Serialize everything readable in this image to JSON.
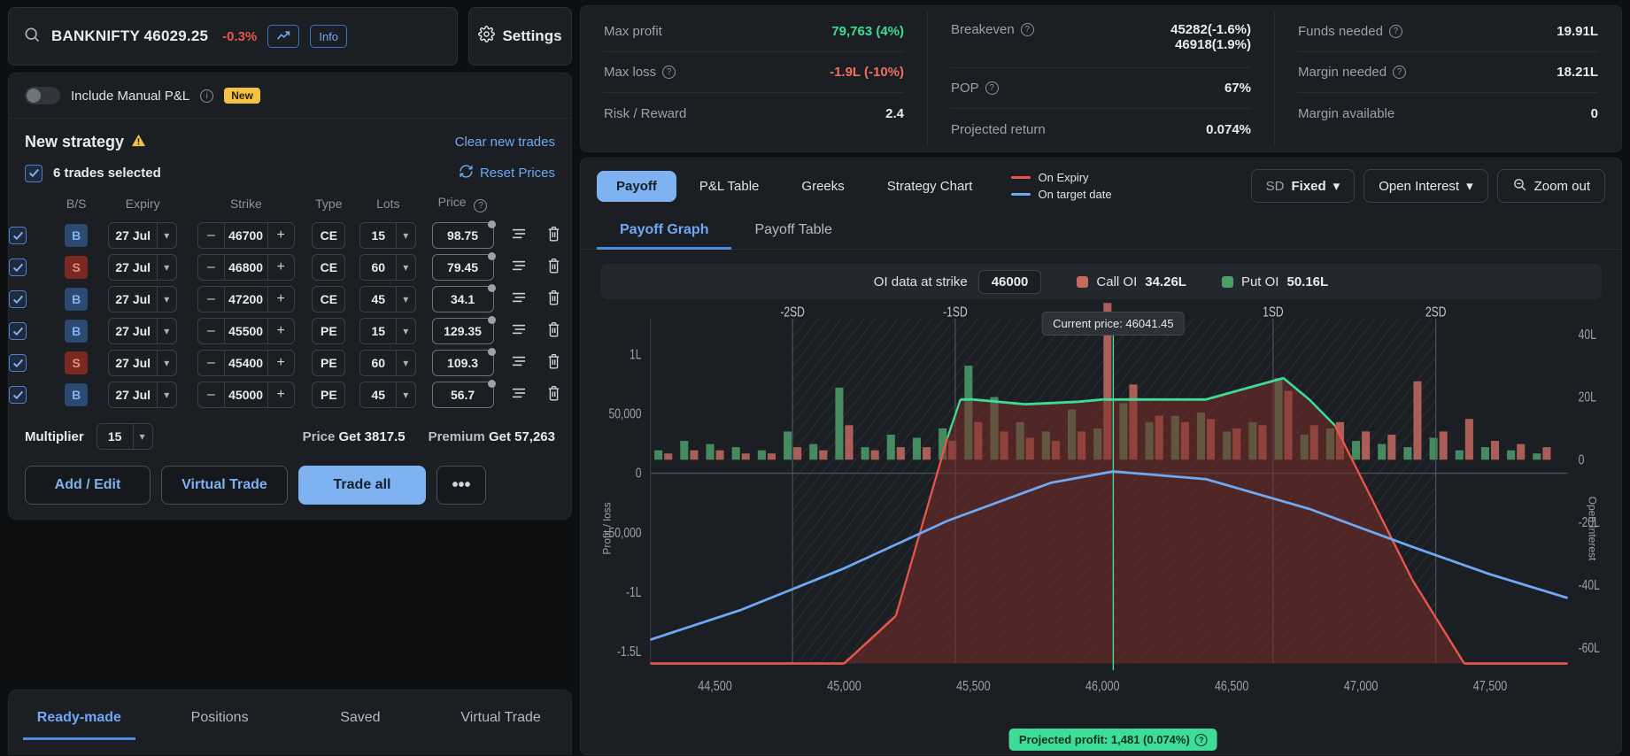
{
  "search": {
    "symbol": "BANKNIFTY 46029.25",
    "change": "-0.3%",
    "chart_icon": "trend-up-icon",
    "info_label": "Info",
    "search_icon": "search-icon"
  },
  "settings": {
    "label": "Settings",
    "icon": "gear-icon"
  },
  "manual_pnl": {
    "label": "Include Manual P&L",
    "badge": "New",
    "info_icon": "info-icon"
  },
  "strategy": {
    "title": "New strategy",
    "warning_icon": "warning-icon",
    "clear_label": "Clear new trades",
    "selected_label": "6 trades selected",
    "reset_label": "Reset Prices",
    "reset_icon": "refresh-icon",
    "columns": [
      "B/S",
      "Expiry",
      "Strike",
      "Type",
      "Lots",
      "Price"
    ],
    "rows": [
      {
        "bs": "B",
        "expiry": "27 Jul",
        "strike": "46700",
        "type": "CE",
        "lots": "15",
        "price": "98.75"
      },
      {
        "bs": "S",
        "expiry": "27 Jul",
        "strike": "46800",
        "type": "CE",
        "lots": "60",
        "price": "79.45"
      },
      {
        "bs": "B",
        "expiry": "27 Jul",
        "strike": "47200",
        "type": "CE",
        "lots": "45",
        "price": "34.1"
      },
      {
        "bs": "B",
        "expiry": "27 Jul",
        "strike": "45500",
        "type": "PE",
        "lots": "15",
        "price": "129.35"
      },
      {
        "bs": "S",
        "expiry": "27 Jul",
        "strike": "45400",
        "type": "PE",
        "lots": "60",
        "price": "109.3"
      },
      {
        "bs": "B",
        "expiry": "27 Jul",
        "strike": "45000",
        "type": "PE",
        "lots": "45",
        "price": "56.7"
      }
    ],
    "multiplier_label": "Multiplier",
    "multiplier_value": "15",
    "price_label": "Price",
    "price_value": "Get 3817.5",
    "premium_label": "Premium",
    "premium_value": "Get 57,263",
    "buttons": {
      "add_edit": "Add / Edit",
      "virtual_trade": "Virtual Trade",
      "trade_all": "Trade all",
      "more": "•••"
    }
  },
  "bottom_tabs": [
    {
      "label": "Ready-made",
      "active": true
    },
    {
      "label": "Positions",
      "active": false
    },
    {
      "label": "Saved",
      "active": false
    },
    {
      "label": "Virtual Trade",
      "active": false
    }
  ],
  "metrics": {
    "col1": [
      {
        "label": "Max profit",
        "value": "79,763 (4%)",
        "tone": "green",
        "help": false
      },
      {
        "label": "Max loss",
        "value": "-1.9L (-10%)",
        "tone": "red",
        "help": true
      },
      {
        "label": "Risk / Reward",
        "value": "2.4",
        "tone": "plain",
        "help": false
      }
    ],
    "col2": [
      {
        "label": "Breakeven",
        "value": "45282(-1.6%)",
        "value2": "46918(1.9%)",
        "tone": "plain",
        "help": true
      },
      {
        "label": "POP",
        "value": "67%",
        "tone": "plain",
        "help": true
      },
      {
        "label": "Projected return",
        "value": "0.074%",
        "tone": "plain",
        "help": false
      }
    ],
    "col3": [
      {
        "label": "Funds needed",
        "value": "19.91L",
        "tone": "plain",
        "help": true
      },
      {
        "label": "Margin needed",
        "value": "18.21L",
        "tone": "plain",
        "help": true
      },
      {
        "label": "Margin available",
        "value": "0",
        "tone": "plain",
        "help": false
      }
    ]
  },
  "chart_controls": {
    "tabs": [
      {
        "label": "Payoff",
        "active": true
      },
      {
        "label": "P&L Table",
        "active": false
      },
      {
        "label": "Greeks",
        "active": false
      },
      {
        "label": "Strategy Chart",
        "active": false
      }
    ],
    "legend": [
      {
        "label": "On Expiry",
        "color": "#e8564a"
      },
      {
        "label": "On target date",
        "color": "#6fa8f5"
      }
    ],
    "sd_prefix": "SD",
    "sd_value": "Fixed",
    "oi_dropdown": "Open Interest",
    "zoom_out": "Zoom out",
    "zoom_icon": "zoom-out-icon",
    "chevron_icon": "chevron-down-icon"
  },
  "sub_tabs": [
    {
      "label": "Payoff Graph",
      "active": true
    },
    {
      "label": "Payoff Table",
      "active": false
    }
  ],
  "oi_bar": {
    "strike_label": "OI data at strike",
    "strike_value": "46000",
    "call_label": "Call OI",
    "call_value": "34.26L",
    "call_color": "#c46a60",
    "put_label": "Put OI",
    "put_value": "50.16L",
    "put_color": "#4e9e6a"
  },
  "chart_annotations": {
    "current_price": "Current price: 46041.45",
    "projected_profit": "Projected profit: 1,481 (0.074%)",
    "y_axis_left_title": "Profit / loss",
    "y_axis_right_title": "Open Interest"
  },
  "chart_data": {
    "type": "line",
    "title": "Payoff Graph",
    "xlabel": "",
    "ylabel": "Profit / loss",
    "y2label": "Open Interest",
    "xlim": [
      44250,
      47800
    ],
    "ylim": [
      -160000,
      130000
    ],
    "y2lim": [
      -65,
      45
    ],
    "xticks": [
      44500,
      45000,
      45500,
      46000,
      46500,
      47000,
      47500
    ],
    "xticklabels": [
      "44,500",
      "45,000",
      "45,500",
      "46,000",
      "46,500",
      "47,000",
      "47,500"
    ],
    "yticks": [
      -150000,
      -100000,
      -50000,
      0,
      50000,
      100000
    ],
    "yticklabels": [
      "-1.5L",
      "-1L",
      "-50,000",
      "0",
      "50,000",
      "1L"
    ],
    "y2ticks": [
      -60,
      -40,
      -20,
      0,
      20,
      40
    ],
    "y2ticklabels": [
      "-60L",
      "-40L",
      "-20L",
      "0",
      "20L",
      "40L"
    ],
    "sd_markers": [
      {
        "label": "-2SD",
        "x": 44800
      },
      {
        "label": "-1SD",
        "x": 45430
      },
      {
        "label": "1SD",
        "x": 46660
      },
      {
        "label": "2SD",
        "x": 47290
      }
    ],
    "current_price_x": 46041.45,
    "grid": false,
    "legend_position": "top-left",
    "series": [
      {
        "name": "On Expiry",
        "color_profit": "#3ddc97",
        "color_loss": "#e8564a",
        "x": [
          44250,
          45000,
          45200,
          45400,
          45450,
          45500,
          45700,
          45900,
          46000,
          46100,
          46400,
          46700,
          46800,
          46900,
          47200,
          47400,
          47800
        ],
        "y": [
          -160000,
          -160000,
          -120000,
          30000,
          62000,
          62000,
          58000,
          60000,
          62000,
          62000,
          62000,
          80000,
          62000,
          40000,
          -90000,
          -160000,
          -160000
        ]
      },
      {
        "name": "On target date",
        "color": "#6fa8f5",
        "x": [
          44250,
          44600,
          45000,
          45400,
          45800,
          46041,
          46400,
          46800,
          47200,
          47500,
          47800
        ],
        "y": [
          -140000,
          -115000,
          -80000,
          -40000,
          -8000,
          1481,
          -5000,
          -30000,
          -62000,
          -85000,
          -105000
        ]
      }
    ],
    "oi_bars": {
      "note": "Open interest histogram, call OI (red) and put OI (green) per strike",
      "strikes": [
        44300,
        44400,
        44500,
        44600,
        44700,
        44800,
        44900,
        45000,
        45100,
        45200,
        45300,
        45400,
        45500,
        45600,
        45700,
        45800,
        45900,
        46000,
        46100,
        46200,
        46300,
        46400,
        46500,
        46600,
        46700,
        46800,
        46900,
        47000,
        47100,
        47200,
        47300,
        47400,
        47500,
        47600,
        47700
      ],
      "put_oi": [
        3,
        6,
        5,
        4,
        3,
        9,
        5,
        23,
        4,
        8,
        7,
        10,
        30,
        20,
        12,
        9,
        16,
        10,
        18,
        12,
        14,
        15,
        9,
        12,
        26,
        8,
        10,
        6,
        5,
        4,
        7,
        3,
        4,
        3,
        2
      ],
      "call_oi": [
        2,
        3,
        3,
        2,
        2,
        4,
        3,
        11,
        3,
        4,
        4,
        6,
        12,
        9,
        7,
        6,
        9,
        50,
        24,
        14,
        12,
        13,
        10,
        11,
        22,
        11,
        12,
        9,
        8,
        25,
        9,
        13,
        6,
        5,
        4
      ]
    }
  }
}
